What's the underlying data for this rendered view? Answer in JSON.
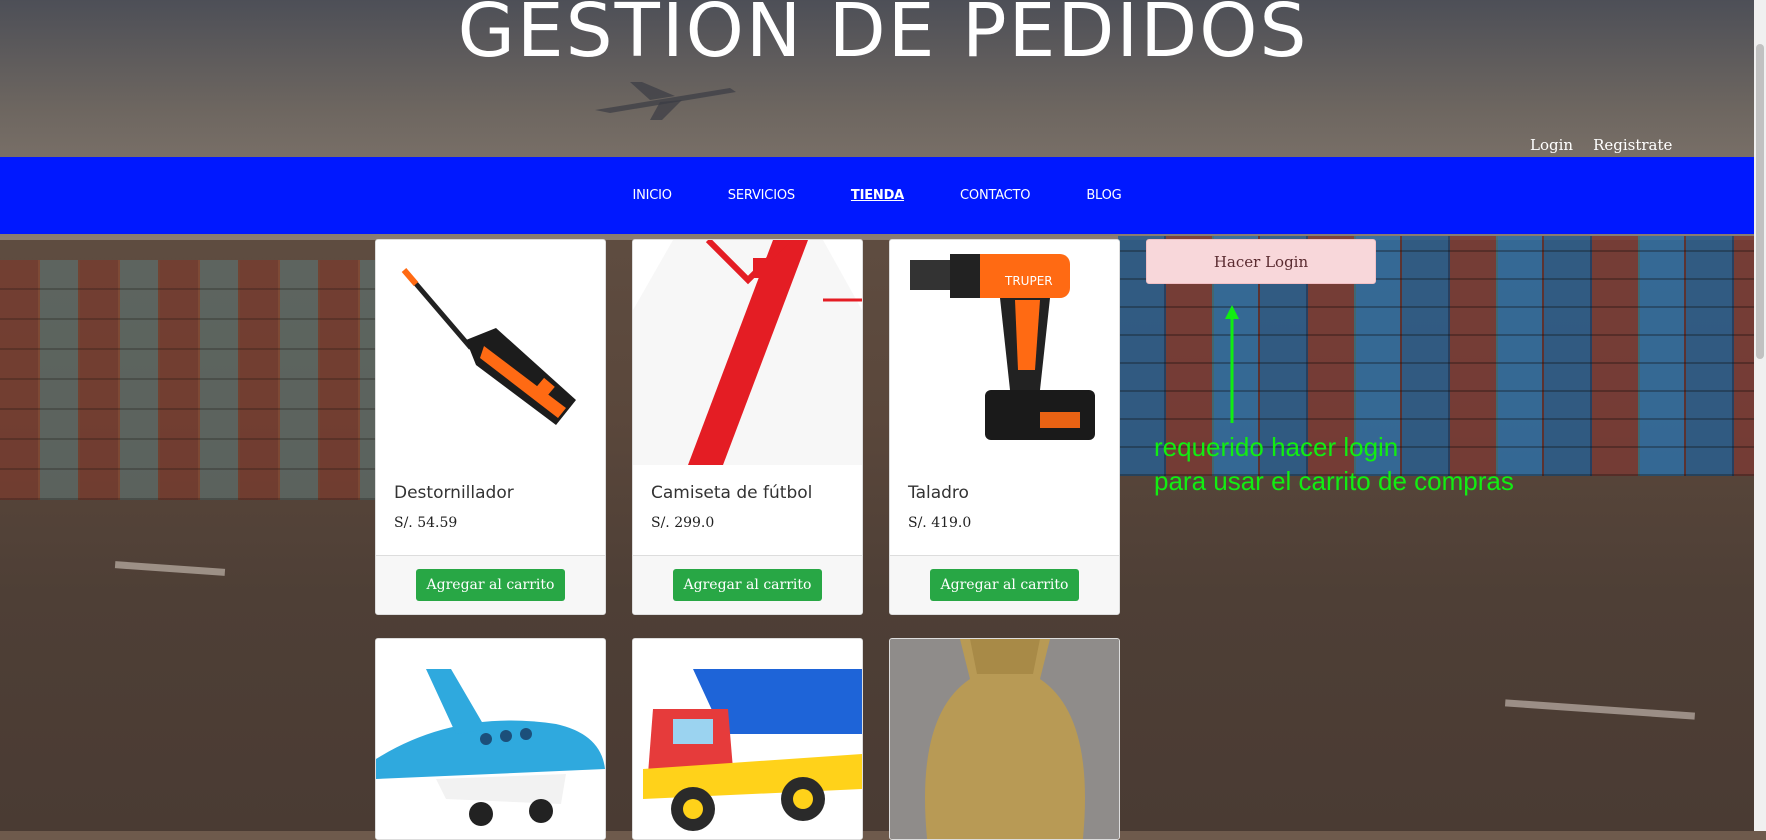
{
  "header": {
    "title": "GESTIÓN DE PEDIDOS",
    "login": "Login",
    "register": "Registrate"
  },
  "nav": [
    {
      "label": "INICIO",
      "active": false
    },
    {
      "label": "SERVICIOS",
      "active": false
    },
    {
      "label": "TIENDA",
      "active": true
    },
    {
      "label": "CONTACTO",
      "active": false
    },
    {
      "label": "BLOG",
      "active": false
    }
  ],
  "products": [
    {
      "name": "Destornillador",
      "price": "S/. 54.59",
      "button": "Agregar al carrito",
      "image": "screwdriver"
    },
    {
      "name": "Camiseta de fútbol",
      "price": "S/. 299.0",
      "button": "Agregar al carrito",
      "image": "peru-jersey"
    },
    {
      "name": "Taladro",
      "price": "S/. 419.0",
      "button": "Agregar al carrito",
      "image": "drill"
    },
    {
      "image": "toy-airplane"
    },
    {
      "image": "toy-truck"
    },
    {
      "image": "vase"
    }
  ],
  "login_notice": "Hacer Login",
  "annotation": {
    "line1": "requerido hacer login",
    "line2": "para usar el carrito de compras"
  },
  "colors": {
    "nav": "#0018ff",
    "button": "#28a745",
    "alert_bg": "#f8d7da",
    "annotation": "#11ee11"
  }
}
